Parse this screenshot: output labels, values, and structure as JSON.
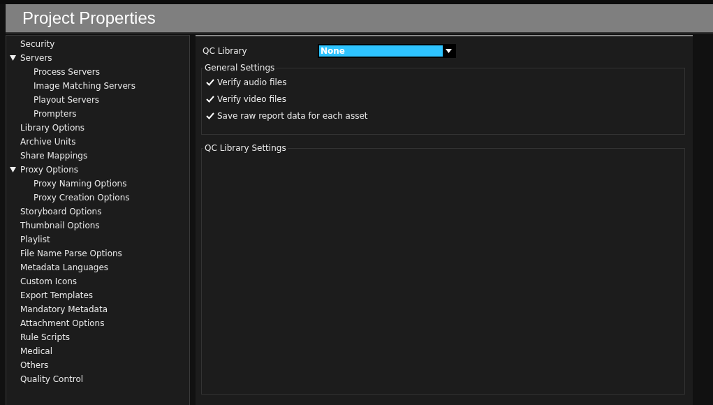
{
  "window": {
    "title": "Project Properties"
  },
  "sidebar": {
    "items": [
      {
        "label": "Security"
      },
      {
        "label": "Servers",
        "expanded": true,
        "children": [
          {
            "label": "Process Servers"
          },
          {
            "label": "Image Matching Servers"
          },
          {
            "label": "Playout Servers"
          },
          {
            "label": "Prompters"
          }
        ]
      },
      {
        "label": "Library Options"
      },
      {
        "label": "Archive Units"
      },
      {
        "label": "Share Mappings"
      },
      {
        "label": "Proxy Options",
        "expanded": true,
        "children": [
          {
            "label": "Proxy Naming Options"
          },
          {
            "label": "Proxy Creation Options"
          }
        ]
      },
      {
        "label": "Storyboard Options"
      },
      {
        "label": "Thumbnail Options"
      },
      {
        "label": "Playlist"
      },
      {
        "label": "File Name Parse Options"
      },
      {
        "label": "Metadata Languages"
      },
      {
        "label": "Custom Icons"
      },
      {
        "label": "Export Templates"
      },
      {
        "label": "Mandatory Metadata"
      },
      {
        "label": "Attachment Options"
      },
      {
        "label": "Rule Scripts"
      },
      {
        "label": "Medical"
      },
      {
        "label": "Others"
      },
      {
        "label": "Quality Control"
      }
    ]
  },
  "qc_library": {
    "label": "QC Library",
    "value": "None"
  },
  "general_settings": {
    "title": "General Settings",
    "options": [
      {
        "label": "Verify audio files",
        "checked": true
      },
      {
        "label": "Verify video files",
        "checked": true
      },
      {
        "label": "Save raw report data for each asset",
        "checked": true
      }
    ]
  },
  "qc_library_settings": {
    "title": "QC Library Settings"
  }
}
